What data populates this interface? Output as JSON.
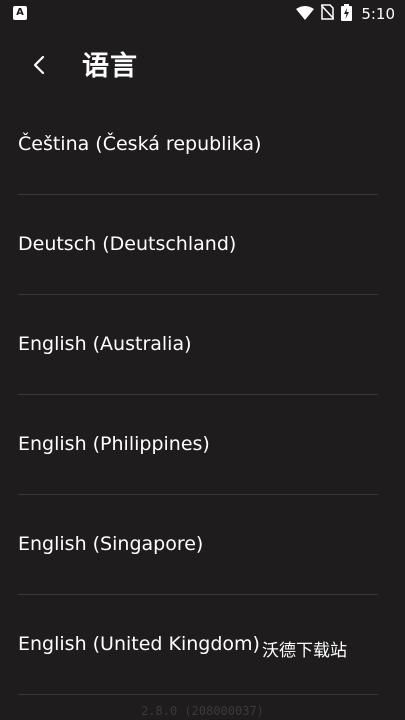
{
  "status_bar": {
    "app_icon_letter": "A",
    "time": "5:10"
  },
  "header": {
    "title": "语言",
    "back_icon": "chevron-left-icon"
  },
  "languages": [
    {
      "label": "Čeština (Česká republika)"
    },
    {
      "label": "Deutsch (Deutschland)"
    },
    {
      "label": "English (Australia)"
    },
    {
      "label": "English (Philippines)"
    },
    {
      "label": "English (Singapore)"
    },
    {
      "label": "English (United Kingdom)"
    }
  ],
  "watermark": "沃德下载站",
  "version": "2.8.0 (208000037)",
  "colors": {
    "background": "#1e1c1c",
    "text": "#ffffff",
    "divider": "#3a3838"
  }
}
